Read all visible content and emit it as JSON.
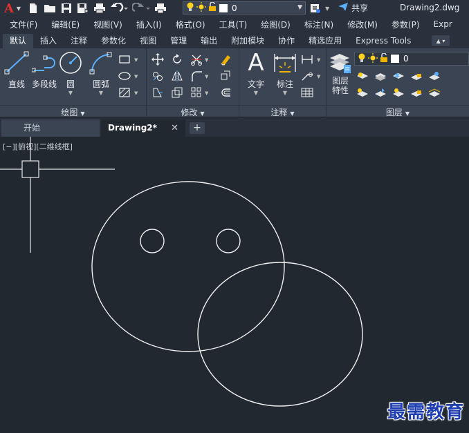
{
  "titlebar": {
    "layer_value": "0",
    "share_label": "共享",
    "document_title": "Drawing2.dwg"
  },
  "menu": [
    "文件(F)",
    "编辑(E)",
    "视图(V)",
    "插入(I)",
    "格式(O)",
    "工具(T)",
    "绘图(D)",
    "标注(N)",
    "修改(M)",
    "参数(P)",
    "Expr"
  ],
  "ribbon_tabs": [
    "默认",
    "插入",
    "注释",
    "参数化",
    "视图",
    "管理",
    "输出",
    "附加模块",
    "协作",
    "精选应用",
    "Express Tools"
  ],
  "ribbon": {
    "draw": {
      "title": "绘图",
      "line": "直线",
      "polyline": "多段线",
      "circle": "圆",
      "arc": "圆弧"
    },
    "modify": {
      "title": "修改"
    },
    "annotation": {
      "title": "注释",
      "text": "文字",
      "dimension": "标注"
    },
    "layers": {
      "title": "图层",
      "properties_line1": "图层",
      "properties_line2": "特性",
      "layer_value": "0"
    }
  },
  "doc_tabs": {
    "start": "开始",
    "active": "Drawing2*"
  },
  "canvas": {
    "viewport_label": "[−][俯视][二维线框]",
    "watermark": "最需教育"
  },
  "colors": {
    "background": "#212830",
    "ribbon": "#3b4452",
    "accent_blue": "#5ab0ff",
    "logo_red": "#e0322b"
  }
}
